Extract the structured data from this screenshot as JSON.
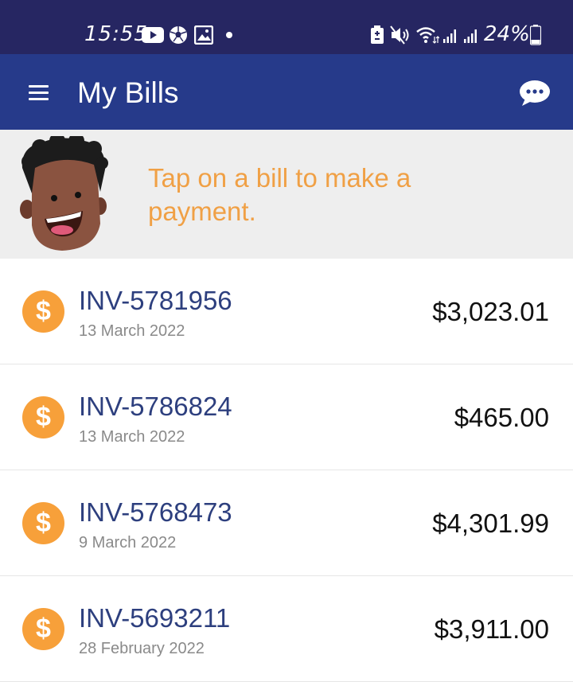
{
  "status_bar": {
    "time": "15:55",
    "battery": "24%",
    "icons": [
      "youtube-icon",
      "soccer-ball-icon",
      "gallery-icon",
      "notification-dot-icon",
      "battery-saver-icon",
      "mute-icon",
      "wifi-icon",
      "signal-icon",
      "signal-icon",
      "battery-icon"
    ]
  },
  "app_bar": {
    "title": "My Bills",
    "icons": [
      "menu-icon",
      "chat-icon"
    ]
  },
  "banner": {
    "message": "Tap on a bill to make a payment.",
    "icon": "avatar-character-icon"
  },
  "bills": [
    {
      "number": "INV-5781956",
      "date": "13 March 2022",
      "amount": "$3,023.01",
      "icon": "dollar-coin-icon"
    },
    {
      "number": "INV-5786824",
      "date": "13 March 2022",
      "amount": "$465.00",
      "icon": "dollar-coin-icon"
    },
    {
      "number": "INV-5768473",
      "date": "9 March 2022",
      "amount": "$4,301.99",
      "icon": "dollar-coin-icon"
    },
    {
      "number": "INV-5693211",
      "date": "28 February 2022",
      "amount": "$3,911.00",
      "icon": "dollar-coin-icon"
    }
  ],
  "coin_symbol": "$",
  "colors": {
    "status_bar": "#262662",
    "app_bar": "#263a8a",
    "banner_bg": "#eeeeee",
    "banner_text": "#f0a045",
    "coin": "#f7a03a",
    "bill_number": "#2d3f7e"
  }
}
